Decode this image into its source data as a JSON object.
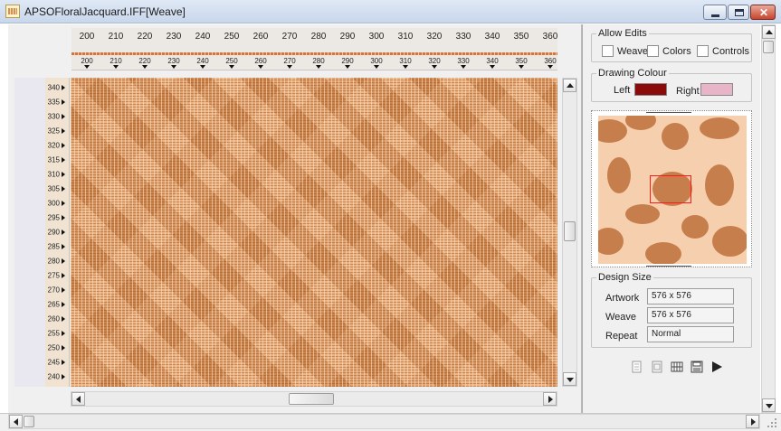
{
  "window": {
    "title": "APSOFloralJacquard.IFF[Weave]"
  },
  "warp_ruler": {
    "labels": [
      "200",
      "210",
      "220",
      "230",
      "240",
      "250",
      "260",
      "270",
      "280",
      "290",
      "300",
      "310",
      "320",
      "330",
      "340",
      "350",
      "360"
    ],
    "labels_small": [
      "200",
      "210",
      "220",
      "230",
      "240",
      "250",
      "260",
      "270",
      "280",
      "290",
      "300",
      "310",
      "320",
      "330",
      "340",
      "350",
      "360"
    ]
  },
  "weft_ruler": {
    "labels": [
      "340",
      "335",
      "330",
      "325",
      "320",
      "315",
      "310",
      "305",
      "300",
      "295",
      "290",
      "285",
      "280",
      "275",
      "270",
      "265",
      "260",
      "255",
      "250",
      "245",
      "240"
    ]
  },
  "allow_edits": {
    "title": "Allow Edits",
    "weave_label": "Weave",
    "colors_label": "Colors",
    "controls_label": "Controls"
  },
  "drawing_colour": {
    "title": "Drawing Colour",
    "left_label": "Left",
    "right_label": "Right",
    "left_color": "#8b0a0a",
    "right_color": "#e8b4c8"
  },
  "design_size": {
    "title": "Design Size",
    "artwork_label": "Artwork",
    "artwork_value": "576 x 576",
    "weave_label": "Weave",
    "weave_value": "576 x 576",
    "repeat_label": "Repeat",
    "repeat_value": "Normal"
  },
  "toolbar": {
    "icons": [
      "copy-page-icon",
      "paste-page-icon",
      "weave-grid-icon",
      "save-disk-icon",
      "play-icon"
    ]
  }
}
